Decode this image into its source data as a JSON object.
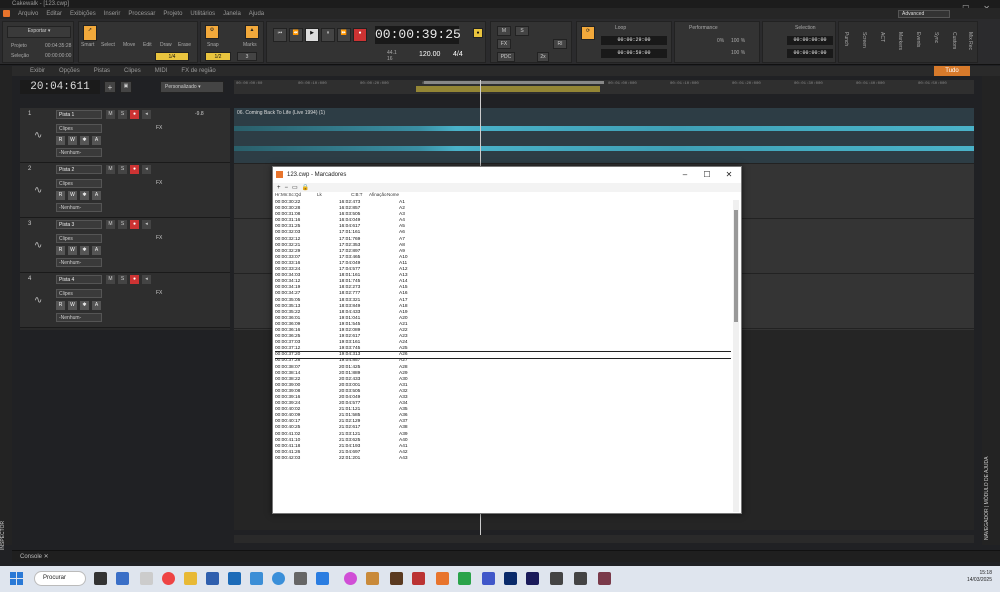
{
  "window": {
    "title": "Cakewalk - [123.cwp]",
    "advanced": "Advanced"
  },
  "menu": [
    "Arquivo",
    "Editar",
    "Exibições",
    "Inserir",
    "Processar",
    "Projeto",
    "Utilitários",
    "Janela",
    "Ajuda"
  ],
  "controlbar": {
    "export": "Exportar",
    "projeto": "Projeto",
    "projeto_time": "00:04:35:28",
    "selecao": "Seleção",
    "selecao_time": "00:00:00:00",
    "tools": [
      "Smart",
      "Select",
      "Move",
      "Edit",
      "Draw",
      "Erase"
    ],
    "snap": "Snap",
    "snap_value": "1/4",
    "snap_value2": "1/2",
    "marks": "Marks",
    "marks_value": "3",
    "time": "00:00:39:25",
    "sample_rate": "44.1",
    "bit": "16",
    "tempo": "120.00",
    "meter": "4/4",
    "mix": [
      "M",
      "S",
      "FX",
      "PDC",
      "2x",
      "RI"
    ],
    "loop_label": "Loop",
    "loop_start": "00:00:29:00",
    "loop_end": "00:00:59:00",
    "performance": "Performance",
    "perf_vals": [
      "0%",
      "100 %",
      "100 %"
    ],
    "selection_label": "Selection",
    "sel_start": "00:00:00:00",
    "sel_end": "00:00:00:00",
    "right_labels": [
      "Punch",
      "Screen",
      "ACT",
      "Markers",
      "Events",
      "Sync",
      "Custom",
      "Mix Rec"
    ]
  },
  "trackview_menu": [
    "Exibir",
    "Opções",
    "Pistas",
    "Clipes",
    "MIDI",
    "FX de região"
  ],
  "trackview_tudo": "Tudo",
  "clock": "20:04:611",
  "personalizado": "Personalizado",
  "ruler_ticks": [
    "00:00:00:00",
    "00:00:10:000",
    "00:00:20:000",
    "00:00:30:000",
    "00:00:40:000",
    "00:00:50:000",
    "00:01:00:000",
    "00:01:10:000",
    "00:01:20:000",
    "00:01:30:000",
    "00:01:40:000",
    "00:01:50:000"
  ],
  "tracks": [
    {
      "num": "1",
      "name": "Pista 1",
      "vol": "-9.8",
      "clips": "Clipes",
      "none": "-Nenhum-",
      "fx": "FX"
    },
    {
      "num": "2",
      "name": "Pista 2",
      "vol": "",
      "clips": "Clipes",
      "none": "-Nenhum-",
      "fx": "FX"
    },
    {
      "num": "3",
      "name": "Pista 3",
      "vol": "",
      "clips": "Clipes",
      "none": "-Nenhum-",
      "fx": "FX"
    },
    {
      "num": "4",
      "name": "Pista 4",
      "vol": "",
      "clips": "Clipes",
      "none": "-Nenhum-",
      "fx": "FX"
    }
  ],
  "track_buttons": {
    "m": "M",
    "s": "S",
    "r": "R",
    "w": "W",
    "a": "A"
  },
  "clip_name": "06. Coming Back To Life (Live 1994) (1)",
  "console": "Console",
  "inspector": "INSPECTOR",
  "right_panel": "NAVEGADOR | MÓDULO DE AJUDA",
  "dialog": {
    "title": "123.cwp - Marcadores",
    "columns": [
      "Hr:Mn:Sc:Qd",
      "Lk",
      "C:B:T",
      "Afinação",
      "Nome"
    ],
    "selected_index": 25,
    "rows": [
      [
        "00:00:30:22",
        "16:02:473",
        "A1"
      ],
      [
        "00:00:30:28",
        "16:02:857",
        "A2"
      ],
      [
        "00:00:31:08",
        "16:03:505",
        "A3"
      ],
      [
        "00:00:31:16",
        "16:04:049",
        "A4"
      ],
      [
        "00:00:31:25",
        "16:04:617",
        "A5"
      ],
      [
        "00:00:32:03",
        "17:01:161",
        "A6"
      ],
      [
        "00:00:32:12",
        "17:01:769",
        "A7"
      ],
      [
        "00:00:32:21",
        "17:02:353",
        "A8"
      ],
      [
        "00:00:32:29",
        "17:02:897",
        "A9"
      ],
      [
        "00:00:33:07",
        "17:03:465",
        "A10"
      ],
      [
        "00:00:33:16",
        "17:04:049",
        "A11"
      ],
      [
        "00:00:33:24",
        "17:04:577",
        "A12"
      ],
      [
        "00:00:34:03",
        "18:01:161",
        "A13"
      ],
      [
        "00:00:34:12",
        "18:01:745",
        "A14"
      ],
      [
        "00:00:34:19",
        "18:02:273",
        "A15"
      ],
      [
        "00:00:34:27",
        "18:02:777",
        "A16"
      ],
      [
        "00:00:35:05",
        "18:03:321",
        "A17"
      ],
      [
        "00:00:35:13",
        "18:03:849",
        "A18"
      ],
      [
        "00:00:35:22",
        "18:04:433",
        "A19"
      ],
      [
        "00:00:36:01",
        "19:01:041",
        "A20"
      ],
      [
        "00:00:36:09",
        "19:01:545",
        "A21"
      ],
      [
        "00:00:36:16",
        "19:02:089",
        "A22"
      ],
      [
        "00:00:36:25",
        "19:02:617",
        "A23"
      ],
      [
        "00:00:37:03",
        "19:03:161",
        "A24"
      ],
      [
        "00:00:37:12",
        "19:03:745",
        "A25"
      ],
      [
        "00:00:37:20",
        "19:04:313",
        "A26"
      ],
      [
        "00:00:37:28",
        "19:04:857",
        "A27"
      ],
      [
        "00:00:38:07",
        "20:01:425",
        "A28"
      ],
      [
        "00:00:38:14",
        "20:01:889",
        "A29"
      ],
      [
        "00:00:38:22",
        "20:02:433",
        "A30"
      ],
      [
        "00:00:39:00",
        "20:03:001",
        "A31"
      ],
      [
        "00:00:39:08",
        "20:03:505",
        "A32"
      ],
      [
        "00:00:39:16",
        "20:04:049",
        "A33"
      ],
      [
        "00:00:39:24",
        "20:04:577",
        "A34"
      ],
      [
        "00:00:40:02",
        "21:01:121",
        "A35"
      ],
      [
        "00:00:40:09",
        "21:01:585",
        "A36"
      ],
      [
        "00:00:40:17",
        "21:02:129",
        "A37"
      ],
      [
        "00:00:40:25",
        "21:02:617",
        "A38"
      ],
      [
        "00:00:41:02",
        "21:03:121",
        "A39"
      ],
      [
        "00:00:41:10",
        "21:03:625",
        "A40"
      ],
      [
        "00:00:41:18",
        "21:04:193",
        "A41"
      ],
      [
        "00:00:41:26",
        "21:04:697",
        "A42"
      ],
      [
        "00:00:42:03",
        "22:01:201",
        "A43"
      ]
    ]
  },
  "taskbar": {
    "search": "Procurar",
    "time": "15:18",
    "date": "14/03/2025"
  }
}
